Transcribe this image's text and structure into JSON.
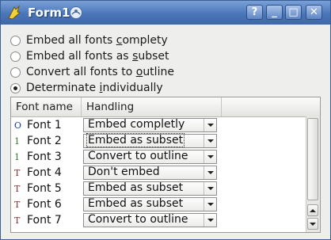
{
  "window": {
    "title": "Form1",
    "controls": {
      "help": "?",
      "minimize": "_",
      "maximize": "□",
      "close": "✕"
    }
  },
  "options": [
    {
      "pre": "Embed all fonts ",
      "key": "c",
      "post": "omplety",
      "selected": false
    },
    {
      "pre": "Embed all fonts as ",
      "key": "s",
      "post": "ubset",
      "selected": false
    },
    {
      "pre": "Convert all fonts to ",
      "key": "o",
      "post": "utline",
      "selected": false
    },
    {
      "pre": "Determinate ",
      "key": "i",
      "post": "ndividually",
      "selected": true
    }
  ],
  "table": {
    "columns": [
      "Font name",
      "Handling"
    ],
    "rows": [
      {
        "icon": "opentype-font-icon",
        "glyph": "O",
        "color": "#1b3b8f",
        "name": "Font 1",
        "handling": "Embed completly"
      },
      {
        "icon": "type1-font-icon",
        "glyph": "1",
        "color": "#2e7d2e",
        "name": "Font 2",
        "handling": "Embed as subset",
        "focused": true
      },
      {
        "icon": "type1-font-icon",
        "glyph": "1",
        "color": "#2e7d2e",
        "name": "Font 3",
        "handling": "Convert to outline"
      },
      {
        "icon": "truetype-font-icon",
        "glyph": "T",
        "color": "#8a2a2a",
        "name": "Font 4",
        "handling": "Don't embed"
      },
      {
        "icon": "truetype-font-icon",
        "glyph": "T",
        "color": "#8a2a2a",
        "name": "Font 5",
        "handling": "Embed as subset"
      },
      {
        "icon": "truetype-font-icon",
        "glyph": "T",
        "color": "#8a2a2a",
        "name": "Font 6",
        "handling": "Embed as subset"
      },
      {
        "icon": "truetype-font-icon",
        "glyph": "T",
        "color": "#8a2a2a",
        "name": "Font 7",
        "handling": "Convert to outline"
      }
    ]
  }
}
